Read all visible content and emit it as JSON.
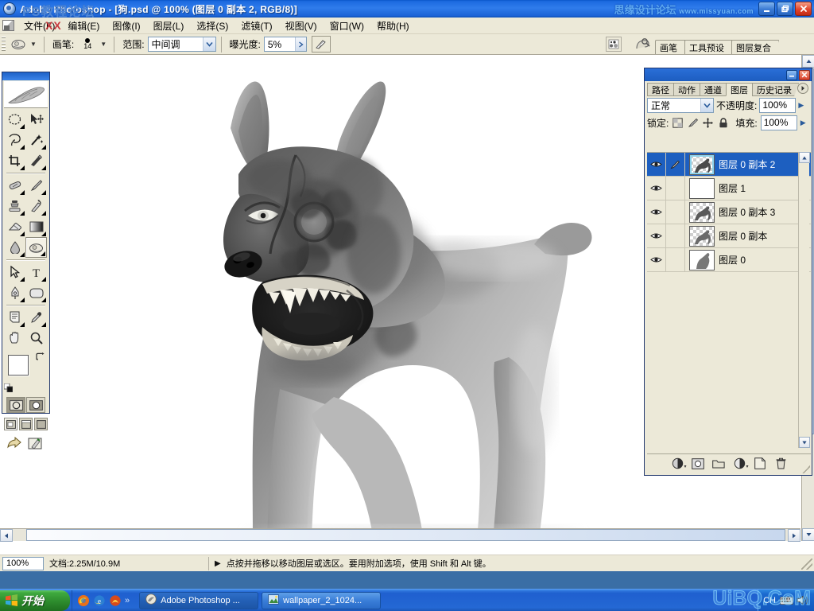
{
  "window": {
    "app_title": "Adobe Photoshop - [狗.psd @ 100% (图层 0 副本 2, RGB/8)]",
    "watermark_title": "PS教程论坛",
    "watermark_right": "思缘设计论坛",
    "watermark_right_url": "www.missyuan.com",
    "minimize": "_",
    "restore": "❐",
    "close": "✕"
  },
  "menubar": {
    "doc_icon": "document-icon",
    "watermark": "XX",
    "items": [
      {
        "label": "文件(F)",
        "name": "menu-file"
      },
      {
        "label": "编辑(E)",
        "name": "menu-edit"
      },
      {
        "label": "图像(I)",
        "name": "menu-image"
      },
      {
        "label": "图层(L)",
        "name": "menu-layer"
      },
      {
        "label": "选择(S)",
        "name": "menu-select"
      },
      {
        "label": "滤镜(T)",
        "name": "menu-filter"
      },
      {
        "label": "视图(V)",
        "name": "menu-view"
      },
      {
        "label": "窗口(W)",
        "name": "menu-window"
      },
      {
        "label": "帮助(H)",
        "name": "menu-help"
      }
    ]
  },
  "optionsbar": {
    "tool_icon": "dodge-burn-tool-icon",
    "brush_label": "画笔:",
    "brush_size": "14",
    "range_label": "范围:",
    "range_value": "中间调",
    "exposure_label": "曝光度:",
    "exposure_value": "5%",
    "airbrush_icon": "airbrush-toggle-icon",
    "brush_palette_icon": "brush-palette-icon"
  },
  "palette_well": {
    "icon": "palette-well-icon",
    "tabs": [
      {
        "label": "画笔",
        "name": "well-tab-brushes"
      },
      {
        "label": "工具预设",
        "name": "well-tab-tool-presets"
      },
      {
        "label": "图层复合",
        "name": "well-tab-layer-comps"
      }
    ]
  },
  "toolbox": {
    "tools": [
      {
        "name": "elliptical-marquee-tool-icon",
        "row": 0,
        "col": 0
      },
      {
        "name": "move-tool-icon",
        "row": 0,
        "col": 1
      },
      {
        "name": "lasso-tool-icon",
        "row": 1,
        "col": 0
      },
      {
        "name": "magic-wand-tool-icon",
        "row": 1,
        "col": 1
      },
      {
        "name": "crop-tool-icon",
        "row": 2,
        "col": 0
      },
      {
        "name": "slice-tool-icon",
        "row": 2,
        "col": 1
      },
      {
        "name": "healing-brush-tool-icon",
        "row": 3,
        "col": 0
      },
      {
        "name": "brush-tool-icon",
        "row": 3,
        "col": 1
      },
      {
        "name": "clone-stamp-tool-icon",
        "row": 4,
        "col": 0
      },
      {
        "name": "history-brush-tool-icon",
        "row": 4,
        "col": 1
      },
      {
        "name": "eraser-tool-icon",
        "row": 5,
        "col": 0
      },
      {
        "name": "gradient-tool-icon",
        "row": 5,
        "col": 1
      },
      {
        "name": "blur-tool-icon",
        "row": 6,
        "col": 0
      },
      {
        "name": "dodge-tool-icon",
        "row": 6,
        "col": 1,
        "selected": true
      },
      {
        "name": "path-selection-tool-icon",
        "row": 7,
        "col": 0
      },
      {
        "name": "type-tool-icon",
        "row": 7,
        "col": 1
      },
      {
        "name": "pen-tool-icon",
        "row": 8,
        "col": 0
      },
      {
        "name": "rectangle-tool-icon",
        "row": 8,
        "col": 1
      },
      {
        "name": "notes-tool-icon",
        "row": 9,
        "col": 0
      },
      {
        "name": "eyedropper-tool-icon",
        "row": 9,
        "col": 1
      },
      {
        "name": "hand-tool-icon",
        "row": 10,
        "col": 0
      },
      {
        "name": "zoom-tool-icon",
        "row": 10,
        "col": 1
      }
    ],
    "foreground_color": "#ffffff",
    "background_color": "#808080",
    "mask_modes": [
      "standard-mask-mode",
      "quick-mask-mode"
    ],
    "screen_modes": [
      "standard-screen-mode",
      "full-screen-menubar-mode",
      "full-screen-mode"
    ],
    "jump_buttons": [
      "jump-to-imageready-icon",
      "jump-to-illustrator-icon"
    ]
  },
  "layers_panel": {
    "tabs": [
      {
        "label": "路径",
        "name": "tab-paths"
      },
      {
        "label": "动作",
        "name": "tab-actions"
      },
      {
        "label": "通道",
        "name": "tab-channels"
      },
      {
        "label": "图层",
        "name": "tab-layers",
        "active": true
      },
      {
        "label": "历史记录",
        "name": "tab-history"
      }
    ],
    "blend_mode": "正常",
    "opacity_label": "不透明度:",
    "opacity_value": "100%",
    "lock_label": "锁定:",
    "lock_icons": [
      "lock-transparent-pixels-icon",
      "lock-image-pixels-icon",
      "lock-position-icon",
      "lock-all-icon"
    ],
    "fill_label": "填充:",
    "fill_value": "100%",
    "layers": [
      {
        "name": "图层 0 副本 2",
        "visible": true,
        "selected": true,
        "thumb": "horse",
        "linked_brush": true
      },
      {
        "name": "图层 1",
        "visible": true,
        "selected": false,
        "thumb": "white"
      },
      {
        "name": "图层 0 副本 3",
        "visible": true,
        "selected": false,
        "thumb": "horse"
      },
      {
        "name": "图层 0 副本",
        "visible": true,
        "selected": false,
        "thumb": "horse"
      },
      {
        "name": "图层 0",
        "visible": true,
        "selected": false,
        "thumb": "horse-solid"
      }
    ],
    "bottom_buttons": [
      {
        "name": "layer-style-button",
        "glyph": "fx"
      },
      {
        "name": "layer-mask-button",
        "glyph": "mask"
      },
      {
        "name": "new-group-button",
        "glyph": "folder"
      },
      {
        "name": "adjustment-layer-button",
        "glyph": "half-circle"
      },
      {
        "name": "new-layer-button",
        "glyph": "page"
      },
      {
        "name": "delete-layer-button",
        "glyph": "trash"
      }
    ]
  },
  "statusbar": {
    "zoom": "100%",
    "doc_info": "文档:2.25M/10.9M",
    "hint": "点按并拖移以移动图层或选区。要用附加选项，使用 Shift 和 Alt 键。",
    "expand_icon": "expand-triangle-icon"
  },
  "taskbar": {
    "start_label": "开始",
    "quick_launch": [
      "firefox-icon",
      "ie-icon",
      "maxthon-icon"
    ],
    "quick_chevron": "»",
    "tasks": [
      {
        "label": "Adobe Photoshop ...",
        "name": "taskbtn-photoshop",
        "active": true,
        "icon": "photoshop-icon"
      },
      {
        "label": "wallpaper_2_1024...",
        "name": "taskbtn-wallpaper",
        "active": false,
        "icon": "image-viewer-icon"
      }
    ],
    "tray": {
      "ime": "CH",
      "icons": [
        "keyboard-icon",
        "speaker-icon"
      ]
    },
    "watermark": "UiBQ.CoM"
  },
  "canvas": {
    "image_title": "狗.psd",
    "zoom_level": "100%",
    "subject": "grayscale-doberman-dog-artwork"
  }
}
